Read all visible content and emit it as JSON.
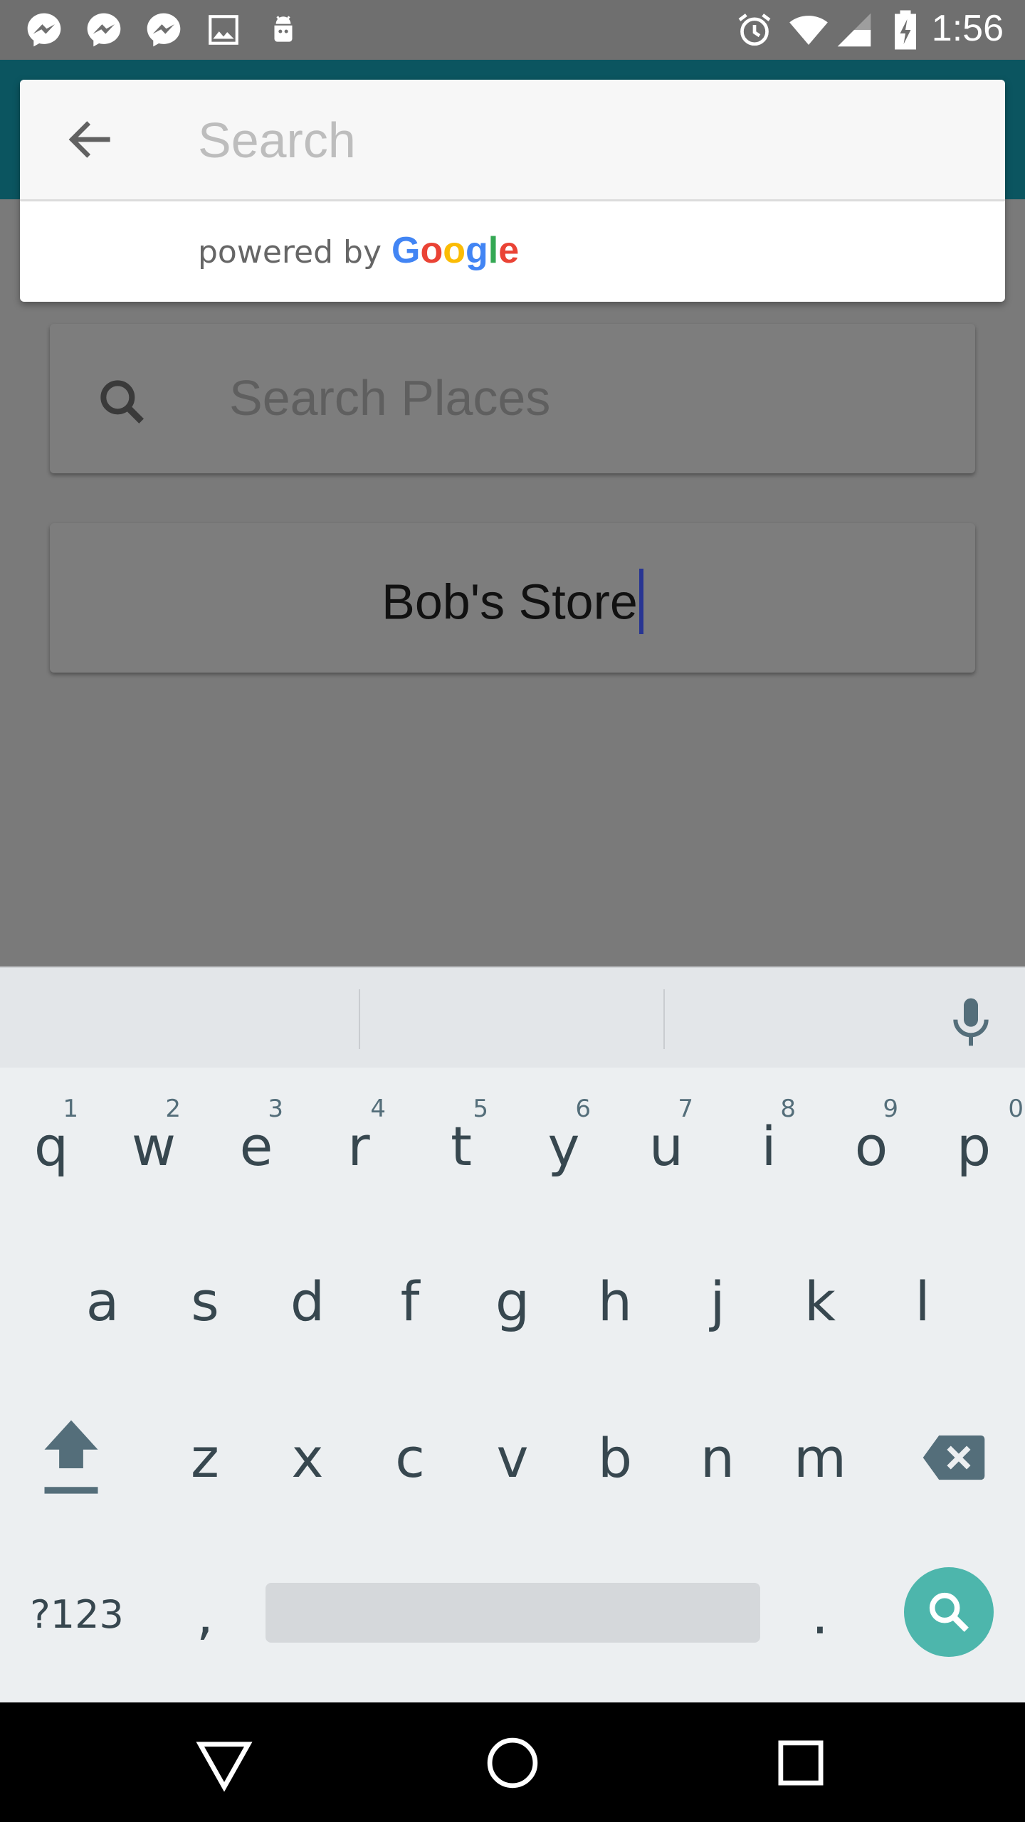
{
  "status_bar": {
    "time": "1:56",
    "icons": [
      "messenger-icon",
      "messenger-icon",
      "messenger-icon",
      "image-icon",
      "android-icon",
      "alarm-icon",
      "wifi-icon",
      "signal-icon",
      "battery-charging-icon"
    ]
  },
  "autocomplete": {
    "search_placeholder": "Search",
    "search_value": "",
    "powered_by": "powered by",
    "google_letters": [
      "G",
      "o",
      "o",
      "g",
      "l",
      "e"
    ],
    "google_colors": [
      "#4285F4",
      "#EA4335",
      "#FBBC05",
      "#4285F4",
      "#34A853",
      "#EA4335"
    ]
  },
  "main": {
    "places_placeholder": "Search Places",
    "name_value": "Bob's Store"
  },
  "keyboard": {
    "row1": [
      {
        "key": "q",
        "hint": "1"
      },
      {
        "key": "w",
        "hint": "2"
      },
      {
        "key": "e",
        "hint": "3"
      },
      {
        "key": "r",
        "hint": "4"
      },
      {
        "key": "t",
        "hint": "5"
      },
      {
        "key": "y",
        "hint": "6"
      },
      {
        "key": "u",
        "hint": "7"
      },
      {
        "key": "i",
        "hint": "8"
      },
      {
        "key": "o",
        "hint": "9"
      },
      {
        "key": "p",
        "hint": "0"
      }
    ],
    "row2": [
      "a",
      "s",
      "d",
      "f",
      "g",
      "h",
      "j",
      "k",
      "l"
    ],
    "row3": [
      "z",
      "x",
      "c",
      "v",
      "b",
      "n",
      "m"
    ],
    "symbols_label": "?123",
    "comma": ",",
    "period": "."
  },
  "colors": {
    "toolbar": "#0b5560",
    "search_action": "#4db6ac",
    "caret": "#283593"
  }
}
